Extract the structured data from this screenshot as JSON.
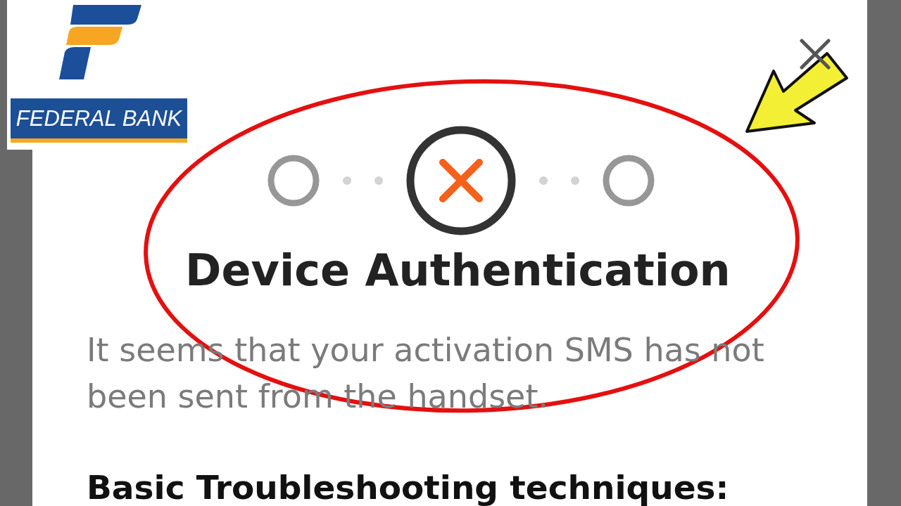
{
  "logo": {
    "wordmark": "FEDERAL BANK"
  },
  "steps": [
    {
      "failed": false
    },
    {
      "failed": true
    },
    {
      "failed": false
    }
  ],
  "title": "Device Authentication",
  "message": "It seems that your activation SMS has not been sent from the handset.",
  "section_heading": "Basic Troubleshooting techniques:"
}
